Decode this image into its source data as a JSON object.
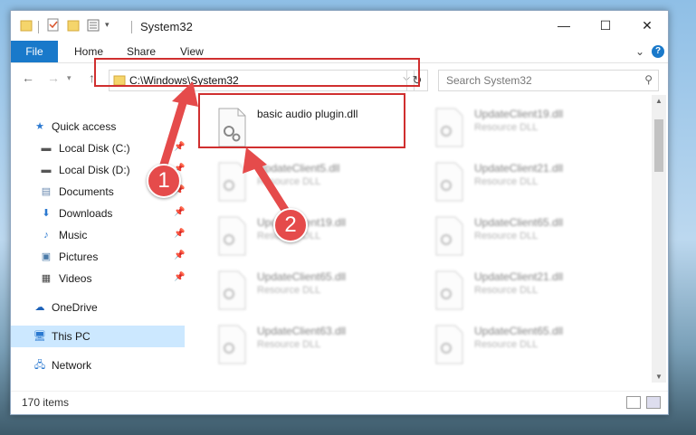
{
  "window": {
    "title": "System32"
  },
  "ribbon": {
    "file": "File",
    "home": "Home",
    "share": "Share",
    "view": "View",
    "chevron": "⌄",
    "help": "?"
  },
  "address": {
    "path": "C:\\Windows\\System32",
    "search_placeholder": "Search System32"
  },
  "nav": {
    "items": [
      {
        "label": "Quick access",
        "icon": "star-icon"
      },
      {
        "label": "Local Disk (C:)",
        "icon": "drive-icon"
      },
      {
        "label": "Local Disk (D:)",
        "icon": "drive-icon"
      },
      {
        "label": "Documents",
        "icon": "documents-icon"
      },
      {
        "label": "Downloads",
        "icon": "download-icon"
      },
      {
        "label": "Music",
        "icon": "music-icon"
      },
      {
        "label": "Pictures",
        "icon": "pictures-icon"
      },
      {
        "label": "Videos",
        "icon": "videos-icon"
      },
      {
        "label": "OneDrive",
        "icon": "cloud-icon"
      },
      {
        "label": "This PC",
        "icon": "pc-icon"
      },
      {
        "label": "Network",
        "icon": "network-icon"
      }
    ]
  },
  "files": [
    {
      "name": "basic audio plugin.dll",
      "type": ""
    },
    {
      "name": "UpdateClient19.dll",
      "type": "Resource DLL"
    },
    {
      "name": "UpdateClient5.dll",
      "type": "Resource DLL"
    },
    {
      "name": "UpdateClient21.dll",
      "type": "Resource DLL"
    },
    {
      "name": "UpdateClient19.dll",
      "type": "Resource DLL"
    },
    {
      "name": "UpdateClient65.dll",
      "type": "Resource DLL"
    },
    {
      "name": "UpdateClient65.dll",
      "type": "Resource DLL"
    },
    {
      "name": "UpdateClient21.dll",
      "type": "Resource DLL"
    },
    {
      "name": "UpdateClient63.dll",
      "type": "Resource DLL"
    },
    {
      "name": "UpdateClient65.dll",
      "type": "Resource DLL"
    }
  ],
  "status": {
    "count": "170 items"
  },
  "annotations": {
    "step1": "1",
    "step2": "2",
    "color": "#e54b4b"
  }
}
